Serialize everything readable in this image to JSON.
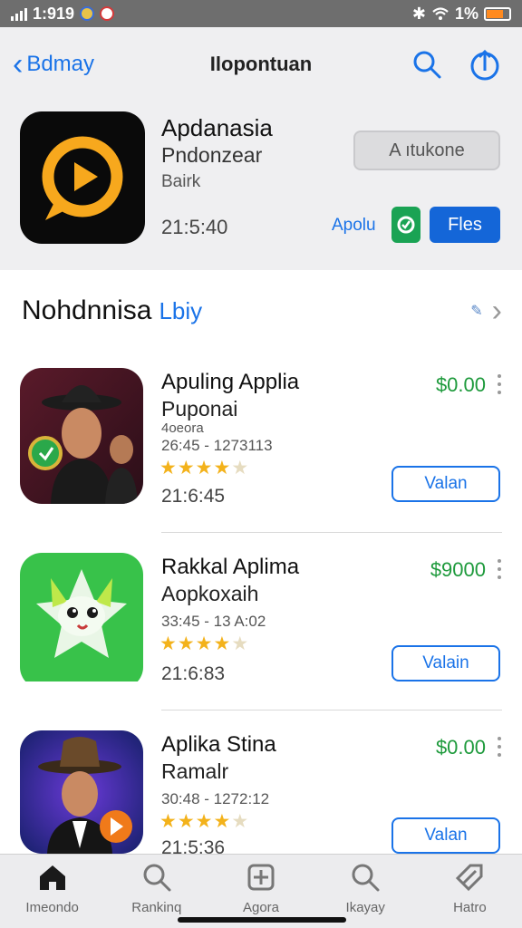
{
  "status_bar": {
    "time": "1:919"
  },
  "navbar": {
    "back_label": "Bdmay",
    "title": "Ilopontuan"
  },
  "hero": {
    "name": "Apdanasia",
    "subtitle": "Pndonzear",
    "developer": "Bairk",
    "time": "21:5:40",
    "input_value": "A ıtukone",
    "link_label": "Apolu",
    "button_label": "Fles"
  },
  "section": {
    "title": "Nohdnnisa",
    "accent": "Lbiy"
  },
  "apps": [
    {
      "title": "Apuling Applia",
      "subtitle": "Puponai",
      "tag": "4oeora",
      "meta": "26:45 - 1273113",
      "time": "21:6:45",
      "price": "$0.00",
      "action": "Valan",
      "rating": 4
    },
    {
      "title": "Rakkal Aplima",
      "subtitle": "Aopkoxaih",
      "tag": "",
      "meta": "33:45 - 13 A:02",
      "time": "21:6:83",
      "price": "$9000",
      "action": "Valain",
      "rating": 4
    },
    {
      "title": "Aplika Stina",
      "subtitle": "Ramalr",
      "tag": "",
      "meta": "30:48 - 1272:12",
      "time": "21:5:36",
      "price": "$0.00",
      "action": "Valan",
      "rating": 4
    }
  ],
  "tabs": [
    {
      "label": "Imeondo",
      "icon": "home-icon"
    },
    {
      "label": "Rankinq",
      "icon": "search-icon"
    },
    {
      "label": "Agora",
      "icon": "add-icon"
    },
    {
      "label": "Ikayay",
      "icon": "search-icon"
    },
    {
      "label": "Hatro",
      "icon": "tag-icon"
    }
  ],
  "colors": {
    "accent": "#1a73e8",
    "price": "#1e9a3c",
    "star": "#f3b21b"
  }
}
